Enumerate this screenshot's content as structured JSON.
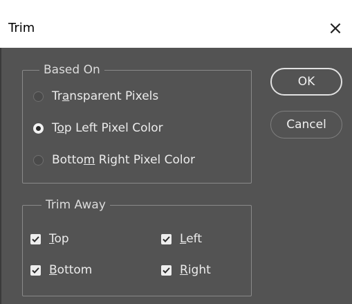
{
  "dialog": {
    "title": "Trim",
    "close_glyph": "×"
  },
  "based_on": {
    "legend": "Based On",
    "options": [
      {
        "pre": "Tr",
        "u": "a",
        "post": "nsparent Pixels",
        "selected": false
      },
      {
        "pre": "T",
        "u": "o",
        "post": "p Left Pixel Color",
        "selected": true
      },
      {
        "pre": "Botto",
        "u": "m",
        "post": " Right Pixel Color",
        "selected": false
      }
    ]
  },
  "trim_away": {
    "legend": "Trim Away",
    "checks": [
      {
        "pre": "",
        "u": "T",
        "post": "op",
        "checked": true
      },
      {
        "pre": "",
        "u": "L",
        "post": "eft",
        "checked": true
      },
      {
        "pre": "",
        "u": "B",
        "post": "ottom",
        "checked": true
      },
      {
        "pre": "",
        "u": "R",
        "post": "ight",
        "checked": true
      }
    ]
  },
  "buttons": {
    "ok": "OK",
    "cancel": "Cancel"
  },
  "colors": {
    "panel": "#535353",
    "titlebar": "#ffffff",
    "text": "#ececec"
  },
  "icons": {
    "close": "close-icon",
    "check": "check-icon",
    "radio": "radio-icon"
  }
}
